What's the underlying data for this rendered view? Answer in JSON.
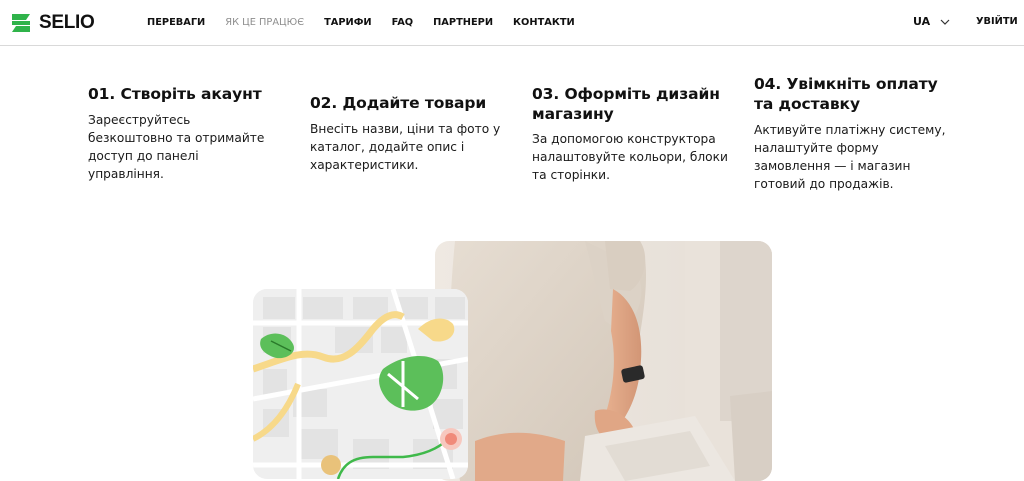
{
  "brand": {
    "name": "SELIO",
    "accent": "#2fb34a"
  },
  "nav": {
    "items": [
      {
        "label": "ПЕРЕВАГИ",
        "active": false
      },
      {
        "label": "ЯК ЦЕ ПРАЦЮЄ",
        "active": true
      },
      {
        "label": "ТАРИФИ",
        "active": false
      },
      {
        "label": "FAQ",
        "active": false
      },
      {
        "label": "ПАРТНЕРИ",
        "active": false
      },
      {
        "label": "КОНТАКТИ",
        "active": false
      }
    ]
  },
  "header": {
    "language": "UA",
    "language_icon": "chevron-down-icon",
    "login_label": "УВІЙТИ"
  },
  "steps": [
    {
      "title": "01. Створіть акаунт",
      "text": "Зареєструйтесь безкоштовно та отримайте доступ до панелі управління."
    },
    {
      "title": "02. Додайте товари",
      "text": "Внесіть назви, ціни та фото у каталог, додайте опис і характеристики."
    },
    {
      "title": "03. Оформіть дизайн магазину",
      "text": "За допомогою конструктора налаштовуйте кольори, блоки та сторінки."
    },
    {
      "title": "04. Увімкніть оплату та доставку",
      "text": "Активуйте платіжну систему, налаштуйте форму замовлення — і магазин готовий до продажів."
    }
  ],
  "images": {
    "photo": "person-packing-parcel-photo",
    "map": "delivery-route-map-illustration"
  },
  "colors": {
    "map_green": "#5cbf5a",
    "map_yellow": "#f7d98a",
    "route": "#3fb94a",
    "pin": "#f08a7a"
  }
}
